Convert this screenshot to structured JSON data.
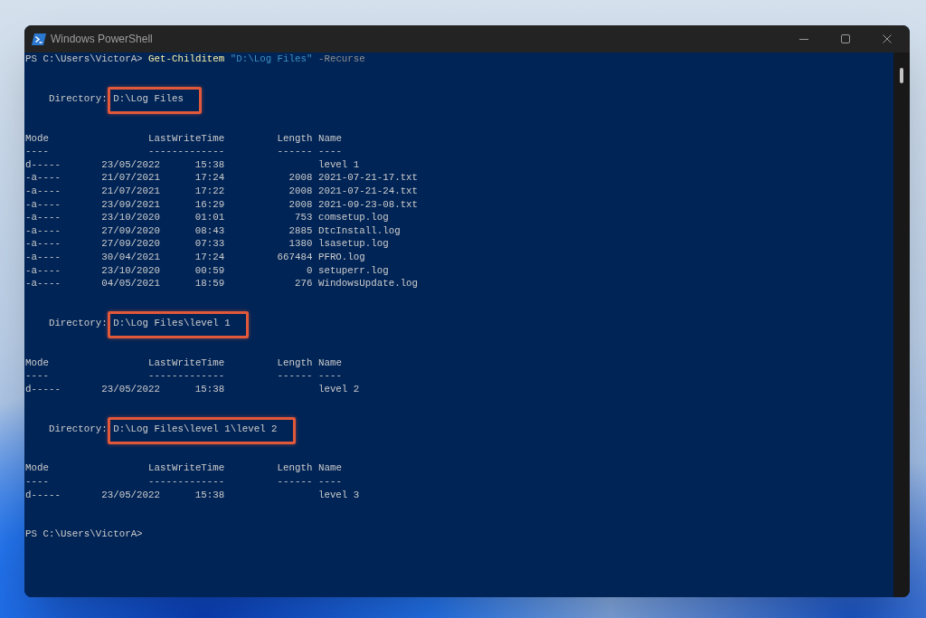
{
  "window": {
    "title": "Windows PowerShell"
  },
  "console": {
    "command": {
      "prompt": "PS C:\\Users\\VictorA>",
      "cmdlet": "Get-Childitem",
      "argument": "\"D:\\Log Files\"",
      "parameter": "-Recurse"
    },
    "listings": [
      {
        "label": "Directory:",
        "path": "D:\\Log Files",
        "highlighted": true,
        "columns": [
          {
            "header": "Mode",
            "underline": "----"
          },
          {
            "header": "LastWriteTime",
            "underline": "-------------"
          },
          {
            "header": "Length",
            "underline": "------"
          },
          {
            "header": "Name",
            "underline": "----"
          }
        ],
        "rows": [
          {
            "mode": "d-----",
            "date": "23/05/2022",
            "time": "15:38",
            "name": "level 1"
          },
          {
            "mode": "-a----",
            "date": "21/07/2021",
            "time": "17:24",
            "length": "2008",
            "name": "2021-07-21-17.txt"
          },
          {
            "mode": "-a----",
            "date": "21/07/2021",
            "time": "17:22",
            "length": "2008",
            "name": "2021-07-21-24.txt"
          },
          {
            "mode": "-a----",
            "date": "23/09/2021",
            "time": "16:29",
            "length": "2008",
            "name": "2021-09-23-08.txt"
          },
          {
            "mode": "-a----",
            "date": "23/10/2020",
            "time": "01:01",
            "length": "753",
            "name": "comsetup.log"
          },
          {
            "mode": "-a----",
            "date": "27/09/2020",
            "time": "08:43",
            "length": "2885",
            "name": "DtcInstall.log"
          },
          {
            "mode": "-a----",
            "date": "27/09/2020",
            "time": "07:33",
            "length": "1380",
            "name": "lsasetup.log"
          },
          {
            "mode": "-a----",
            "date": "30/04/2021",
            "time": "17:24",
            "length": "667484",
            "name": "PFRO.log"
          },
          {
            "mode": "-a----",
            "date": "23/10/2020",
            "time": "00:59",
            "length": "0",
            "name": "setuperr.log"
          },
          {
            "mode": "-a----",
            "date": "04/05/2021",
            "time": "18:59",
            "length": "276",
            "name": "WindowsUpdate.log"
          }
        ]
      },
      {
        "label": "Directory:",
        "path": "D:\\Log Files\\level 1",
        "highlighted": true,
        "columns": [
          {
            "header": "Mode",
            "underline": "----"
          },
          {
            "header": "LastWriteTime",
            "underline": "-------------"
          },
          {
            "header": "Length",
            "underline": "------"
          },
          {
            "header": "Name",
            "underline": "----"
          }
        ],
        "rows": [
          {
            "mode": "d-----",
            "date": "23/05/2022",
            "time": "15:38",
            "name": "level 2"
          }
        ]
      },
      {
        "label": "Directory:",
        "path": "D:\\Log Files\\level 1\\level 2",
        "highlighted": true,
        "columns": [
          {
            "header": "Mode",
            "underline": "----"
          },
          {
            "header": "LastWriteTime",
            "underline": "-------------"
          },
          {
            "header": "Length",
            "underline": "------"
          },
          {
            "header": "Name",
            "underline": "----"
          }
        ],
        "rows": [
          {
            "mode": "d-----",
            "date": "23/05/2022",
            "time": "15:38",
            "name": "level 3"
          }
        ]
      }
    ],
    "prompt": "PS C:\\Users\\VictorA>"
  }
}
